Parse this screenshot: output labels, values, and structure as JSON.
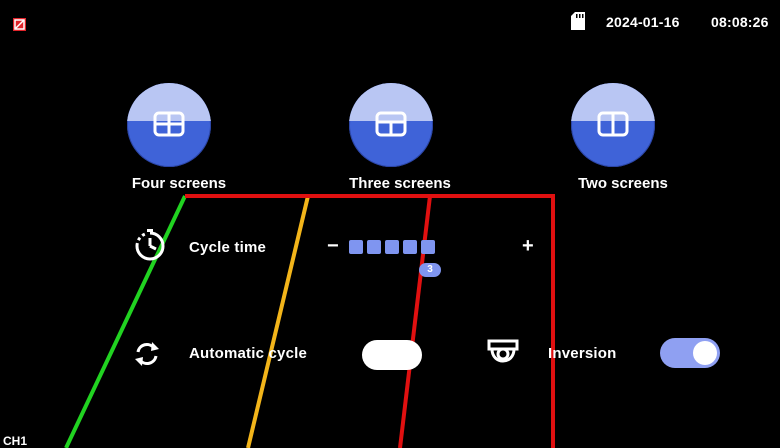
{
  "status_bar": {
    "date": "2024-01-16",
    "time": "08:08:26",
    "no_signal_icon": "no-signal-icon",
    "sd_card_icon": "sd-card-icon"
  },
  "modes": [
    {
      "label": "Four screens",
      "icon": "four-grid-icon"
    },
    {
      "label": "Three screens",
      "icon": "three-grid-icon"
    },
    {
      "label": "Two screens",
      "icon": "two-grid-icon"
    }
  ],
  "cycle_time": {
    "label": "Cycle time",
    "minus": "−",
    "plus": "+",
    "value": "3",
    "segments": 5,
    "icon": "timer-icon"
  },
  "automatic_cycle": {
    "label": "Automatic cycle",
    "enabled": false,
    "icon": "refresh-icon"
  },
  "inversion": {
    "label": "Inversion",
    "enabled": true,
    "icon": "camera-icon"
  },
  "channel": {
    "label": "CH1"
  },
  "colors": {
    "accent": "#7f95f0",
    "button": "#3f63d8",
    "guide_green": "#21d321",
    "guide_yellow": "#f3b51a",
    "guide_red": "#e01010"
  }
}
